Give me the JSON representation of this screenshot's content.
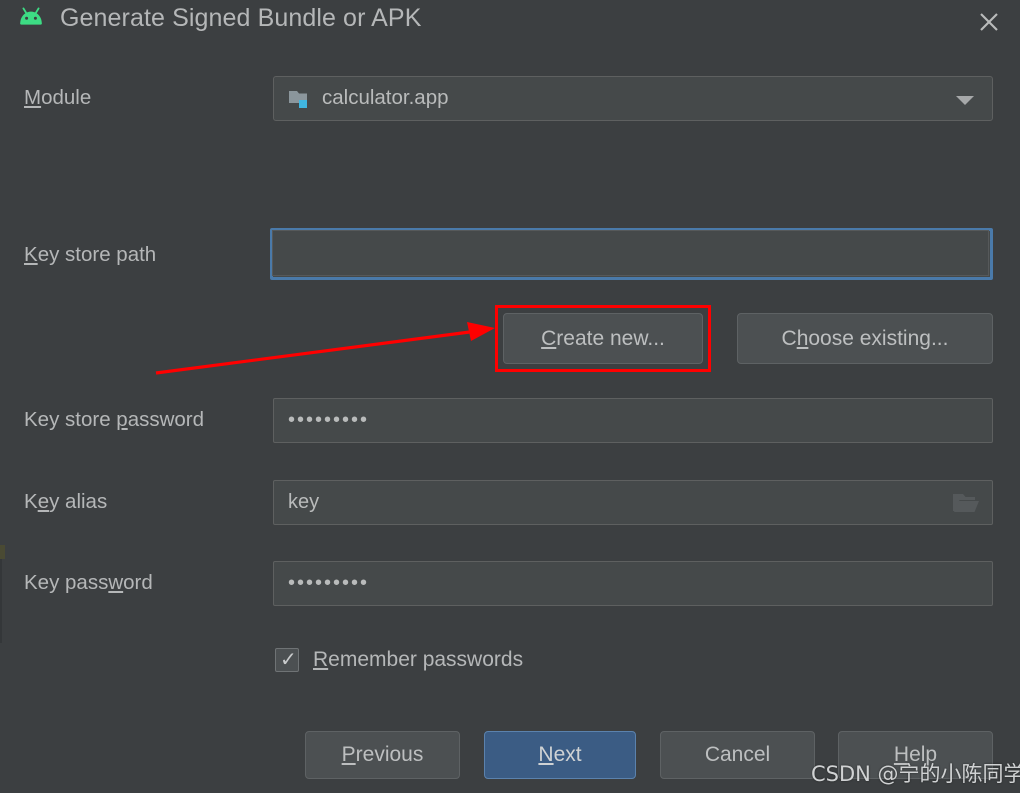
{
  "window": {
    "title": "Generate Signed Bundle or APK",
    "app_icon": "android-robot-icon",
    "close_icon": "close-icon"
  },
  "form": {
    "module": {
      "label": "Module",
      "mnemonic": "M",
      "value": "calculator.app",
      "icon": "module-folder-icon",
      "arrow_icon": "chevron-down-icon"
    },
    "keystore_path": {
      "label": "Key store path",
      "mnemonic": "K",
      "value": "",
      "placeholder": "",
      "focused": true
    },
    "create_new_button": {
      "label": "Create new...",
      "mnemonic": "C"
    },
    "choose_existing_button": {
      "label": "Choose existing...",
      "mnemonic": "h"
    },
    "keystore_password": {
      "label": "Key store password",
      "mnemonic": "p",
      "value": "•••••••••",
      "masked_length": 9
    },
    "key_alias": {
      "label": "Key alias",
      "mnemonic": "e",
      "value": "key",
      "browse_icon": "folder-open-icon"
    },
    "key_password": {
      "label": "Key password",
      "mnemonic": "w",
      "value": "•••••••••",
      "masked_length": 9
    },
    "remember_passwords": {
      "label": "Remember passwords",
      "mnemonic": "R",
      "checked": true,
      "check_glyph": "✓"
    }
  },
  "footer": {
    "previous": "Previous",
    "next": "Next",
    "cancel": "Cancel",
    "help": "Help"
  },
  "annotations": {
    "highlight_target": "create-new-button",
    "arrow": "red-arrow-pointing-to-create-new",
    "color": "#ff0000"
  },
  "watermark": {
    "text": "CSDN @宁的小陈同学"
  },
  "colors": {
    "dialog_bg": "#3c3f41",
    "field_bg": "#45494a",
    "button_bg": "#4c5052",
    "primary_button_bg": "#3b5c84",
    "focus_ring": "#4a7aaa",
    "text": "#b5b7b8",
    "accent_green": "#3ddc84",
    "annotation_red": "#ff0000"
  }
}
